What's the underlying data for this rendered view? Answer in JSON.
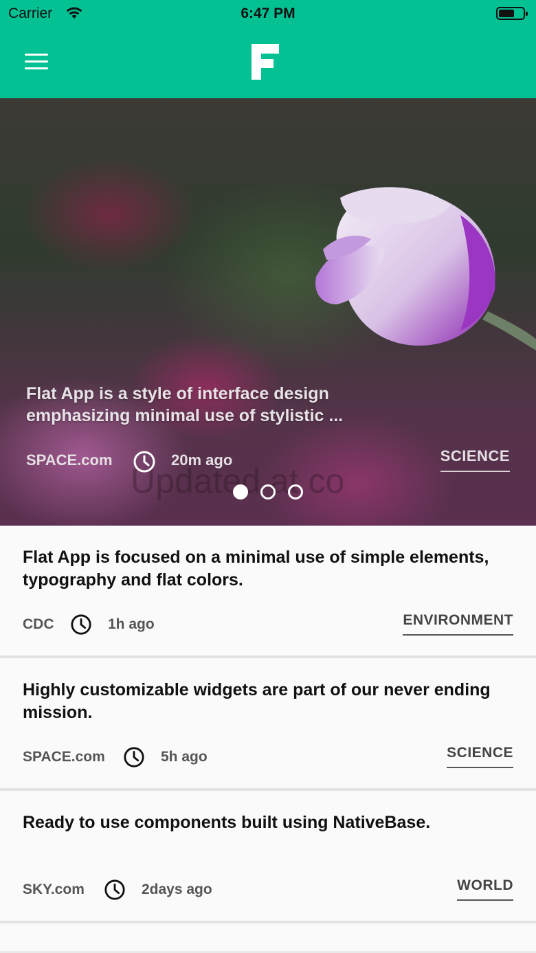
{
  "status_bar": {
    "carrier": "Carrier",
    "time": "6:47 PM"
  },
  "header": {
    "menu_icon": "hamburger-menu-icon",
    "logo_letter": "F",
    "accent_color": "#04c193"
  },
  "hero": {
    "title": "Flat App is a style of interface design emphasizing minimal use of stylistic ...",
    "source": "SPACE.com",
    "time": "20m ago",
    "category": "SCIENCE",
    "watermark": "Updated at co",
    "slides_count": 3,
    "active_slide": 1
  },
  "feed": {
    "items": [
      {
        "title": "Flat App is focused on a minimal use of simple elements, typography and flat colors.",
        "source": "CDC",
        "time": "1h ago",
        "category": "ENVIRONMENT"
      },
      {
        "title": "Highly customizable widgets are part of our never ending mission.",
        "source": "SPACE.com",
        "time": "5h ago",
        "category": "SCIENCE"
      },
      {
        "title": "Ready to use components built using NativeBase.",
        "source": "SKY.com",
        "time": "2days ago",
        "category": "WORLD"
      }
    ]
  }
}
